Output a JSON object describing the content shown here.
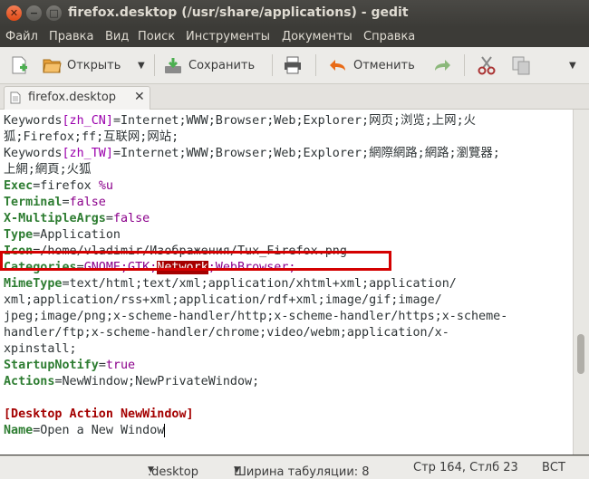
{
  "window": {
    "title": "firefox.desktop (/usr/share/applications) - gedit"
  },
  "menubar": {
    "items": [
      "Файл",
      "Правка",
      "Вид",
      "Поиск",
      "Инструменты",
      "Документы",
      "Справка"
    ]
  },
  "toolbar": {
    "open_label": "Открыть",
    "save_label": "Сохранить",
    "undo_label": "Отменить"
  },
  "tab": {
    "label": "firefox.desktop"
  },
  "editor": {
    "lines": {
      "l1_key": "Keywords",
      "l1_loc": "[zh_CN]",
      "l1_rest": "=Internet;WWW;Browser;Web;Explorer;网页;浏览;上网;火",
      "l2": "狐;Firefox;ff;互联网;网站;",
      "l3_key": "Keywords",
      "l3_loc": "[zh_TW]",
      "l3_rest": "=Internet;WWW;Browser;Web;Explorer;網際網路;網路;瀏覽器;",
      "l4": "上網;網頁;火狐",
      "l5_key": "Exec",
      "l5_val": "=firefox ",
      "l5_arg": "%u",
      "l6_key": "Terminal",
      "l6_eq": "=",
      "l6_val": "false",
      "l7_key": "X-MultipleArgs",
      "l7_eq": "=",
      "l7_val": "false",
      "l8_key": "Type",
      "l8_val": "=Application",
      "l9_key": "Icon",
      "l9_val": "=/home/vladimir/Изображения/Tux_Firefox.png",
      "l10_key": "Categories",
      "l10_eq": "=",
      "l10_a": "GNOME;GTK;",
      "l10_b": "Network",
      "l10_c": ";WebBrowser;",
      "l11_key": "MimeType",
      "l11_val": "=text/html;text/xml;application/xhtml+xml;application/",
      "l12": "xml;application/rss+xml;application/rdf+xml;image/gif;image/",
      "l13": "jpeg;image/png;x-scheme-handler/http;x-scheme-handler/https;x-scheme-",
      "l14": "handler/ftp;x-scheme-handler/chrome;video/webm;application/x-",
      "l15": "xpinstall;",
      "l16_key": "StartupNotify",
      "l16_eq": "=",
      "l16_val": "true",
      "l17_key": "Actions",
      "l17_val": "=NewWindow;NewPrivateWindow;",
      "l19": "[Desktop Action NewWindow]",
      "l20_key": "Name",
      "l20_val": "=Open a New Window"
    }
  },
  "status": {
    "language": ".desktop",
    "tab_width": "Ширина табуляции: 8",
    "position": "Стр 164, Стлб 23",
    "mode": "ВСТ"
  },
  "colors": {
    "highlight_box": "#d40000",
    "key_green": "#2e7d32",
    "value_purple": "#8b008b"
  }
}
